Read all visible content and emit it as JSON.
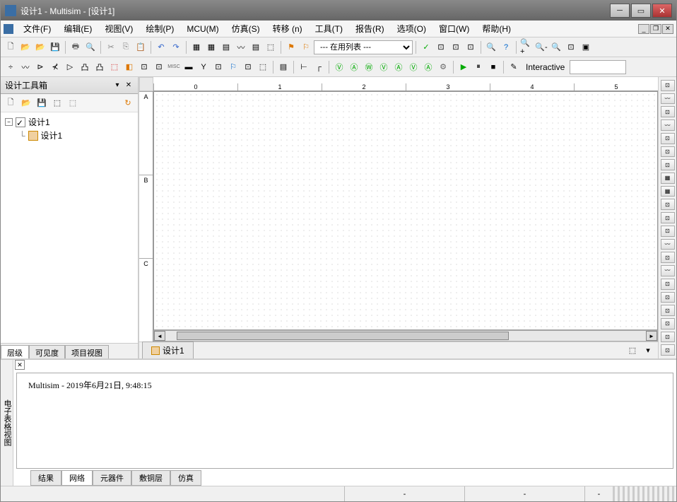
{
  "title": "设计1 - Multisim - [设计1]",
  "menu": [
    "文件(F)",
    "编辑(E)",
    "视图(V)",
    "绘制(P)",
    "MCU(M)",
    "仿真(S)",
    "转移 (n)",
    "工具(T)",
    "报告(R)",
    "选项(O)",
    "窗口(W)",
    "帮助(H)"
  ],
  "toolbar1": {
    "combo": "--- 在用列表 ---"
  },
  "toolbar2": {
    "interactive": "Interactive"
  },
  "leftPanel": {
    "title": "设计工具箱",
    "tree": {
      "root": "设计1",
      "child": "设计1"
    },
    "tabs": [
      "层级",
      "可见度",
      "项目视图"
    ],
    "activeTab": 0
  },
  "canvas": {
    "ruler_h": [
      "0",
      "1",
      "2",
      "3",
      "4",
      "5"
    ],
    "ruler_v": [
      "A",
      "B",
      "C"
    ],
    "docTab": "设计1"
  },
  "output": {
    "sideLabel": "电子表格视图",
    "message": "Multisim  -  2019年6月21日, 9:48:15",
    "tabs": [
      "结果",
      "网络",
      "元器件",
      "敷铜层",
      "仿真"
    ],
    "activeTab": 1
  },
  "status": {
    "cells": [
      "-",
      "-",
      "-"
    ]
  }
}
